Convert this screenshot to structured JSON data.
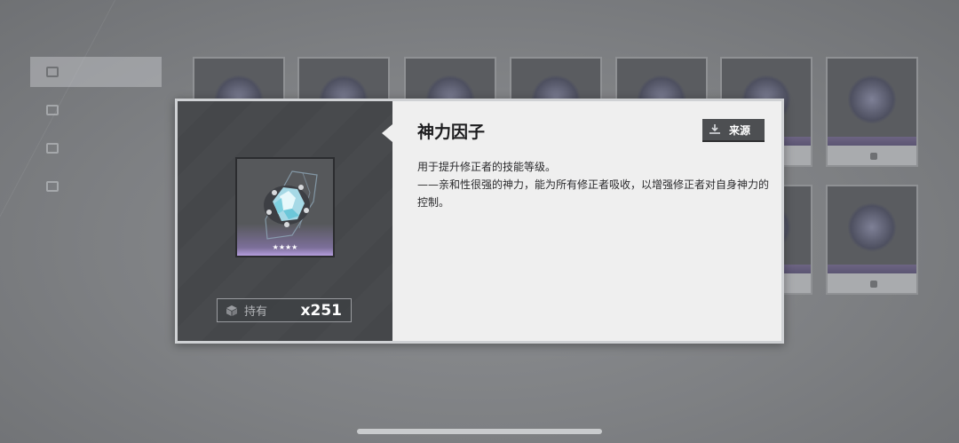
{
  "item": {
    "name": "神力因子",
    "rarity_stars": "★★★★",
    "owned_label": "持有",
    "owned_count": "x251",
    "source_button_label": "来源",
    "description": [
      "用于提升修正者的技能等级。",
      "——亲和性很强的神力，能为所有修正者吸收，以增强修正者对自身神力的控制。"
    ]
  },
  "icons": {
    "bag": "bag-icon",
    "source": "download-icon",
    "item_art": "crystal-gem-icon"
  },
  "colors": {
    "accent_purple": "#b49ddc",
    "panel_light": "#efefef",
    "panel_dark": "#484a4d",
    "button_dark": "#4d4f52"
  }
}
